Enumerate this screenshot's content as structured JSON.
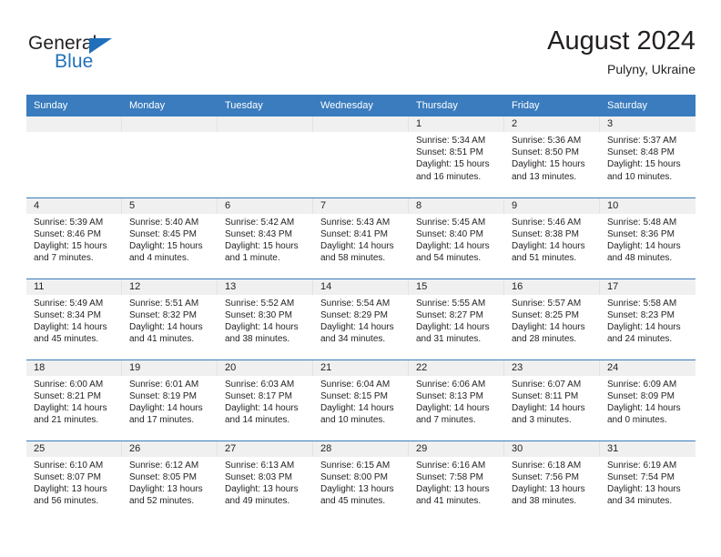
{
  "brand": {
    "name_part1": "General",
    "name_part2": "Blue",
    "triangle_color": "#1f6fba",
    "blue_color": "#2272b8",
    "dark_color": "#231f20"
  },
  "header": {
    "title": "August 2024",
    "subtitle": "Pulyny, Ukraine"
  },
  "theme": {
    "header_bg": "#3a7cbe",
    "daynum_bg": "#f0f0f0",
    "cell_bg": "#ffffff",
    "text": "#231f20"
  },
  "weekday_headers": [
    "Sunday",
    "Monday",
    "Tuesday",
    "Wednesday",
    "Thursday",
    "Friday",
    "Saturday"
  ],
  "labels": {
    "sunrise_prefix": "Sunrise:",
    "sunset_prefix": "Sunset:",
    "daylight_prefix": "Daylight:"
  },
  "weeks": [
    [
      {
        "day": "",
        "empty": true
      },
      {
        "day": "",
        "empty": true
      },
      {
        "day": "",
        "empty": true
      },
      {
        "day": "",
        "empty": true
      },
      {
        "day": "1",
        "sunrise": "Sunrise: 5:34 AM",
        "sunset": "Sunset: 8:51 PM",
        "daylight_l1": "Daylight: 15 hours",
        "daylight_l2": "and 16 minutes."
      },
      {
        "day": "2",
        "sunrise": "Sunrise: 5:36 AM",
        "sunset": "Sunset: 8:50 PM",
        "daylight_l1": "Daylight: 15 hours",
        "daylight_l2": "and 13 minutes."
      },
      {
        "day": "3",
        "sunrise": "Sunrise: 5:37 AM",
        "sunset": "Sunset: 8:48 PM",
        "daylight_l1": "Daylight: 15 hours",
        "daylight_l2": "and 10 minutes."
      }
    ],
    [
      {
        "day": "4",
        "sunrise": "Sunrise: 5:39 AM",
        "sunset": "Sunset: 8:46 PM",
        "daylight_l1": "Daylight: 15 hours",
        "daylight_l2": "and 7 minutes."
      },
      {
        "day": "5",
        "sunrise": "Sunrise: 5:40 AM",
        "sunset": "Sunset: 8:45 PM",
        "daylight_l1": "Daylight: 15 hours",
        "daylight_l2": "and 4 minutes."
      },
      {
        "day": "6",
        "sunrise": "Sunrise: 5:42 AM",
        "sunset": "Sunset: 8:43 PM",
        "daylight_l1": "Daylight: 15 hours",
        "daylight_l2": "and 1 minute."
      },
      {
        "day": "7",
        "sunrise": "Sunrise: 5:43 AM",
        "sunset": "Sunset: 8:41 PM",
        "daylight_l1": "Daylight: 14 hours",
        "daylight_l2": "and 58 minutes."
      },
      {
        "day": "8",
        "sunrise": "Sunrise: 5:45 AM",
        "sunset": "Sunset: 8:40 PM",
        "daylight_l1": "Daylight: 14 hours",
        "daylight_l2": "and 54 minutes."
      },
      {
        "day": "9",
        "sunrise": "Sunrise: 5:46 AM",
        "sunset": "Sunset: 8:38 PM",
        "daylight_l1": "Daylight: 14 hours",
        "daylight_l2": "and 51 minutes."
      },
      {
        "day": "10",
        "sunrise": "Sunrise: 5:48 AM",
        "sunset": "Sunset: 8:36 PM",
        "daylight_l1": "Daylight: 14 hours",
        "daylight_l2": "and 48 minutes."
      }
    ],
    [
      {
        "day": "11",
        "sunrise": "Sunrise: 5:49 AM",
        "sunset": "Sunset: 8:34 PM",
        "daylight_l1": "Daylight: 14 hours",
        "daylight_l2": "and 45 minutes."
      },
      {
        "day": "12",
        "sunrise": "Sunrise: 5:51 AM",
        "sunset": "Sunset: 8:32 PM",
        "daylight_l1": "Daylight: 14 hours",
        "daylight_l2": "and 41 minutes."
      },
      {
        "day": "13",
        "sunrise": "Sunrise: 5:52 AM",
        "sunset": "Sunset: 8:30 PM",
        "daylight_l1": "Daylight: 14 hours",
        "daylight_l2": "and 38 minutes."
      },
      {
        "day": "14",
        "sunrise": "Sunrise: 5:54 AM",
        "sunset": "Sunset: 8:29 PM",
        "daylight_l1": "Daylight: 14 hours",
        "daylight_l2": "and 34 minutes."
      },
      {
        "day": "15",
        "sunrise": "Sunrise: 5:55 AM",
        "sunset": "Sunset: 8:27 PM",
        "daylight_l1": "Daylight: 14 hours",
        "daylight_l2": "and 31 minutes."
      },
      {
        "day": "16",
        "sunrise": "Sunrise: 5:57 AM",
        "sunset": "Sunset: 8:25 PM",
        "daylight_l1": "Daylight: 14 hours",
        "daylight_l2": "and 28 minutes."
      },
      {
        "day": "17",
        "sunrise": "Sunrise: 5:58 AM",
        "sunset": "Sunset: 8:23 PM",
        "daylight_l1": "Daylight: 14 hours",
        "daylight_l2": "and 24 minutes."
      }
    ],
    [
      {
        "day": "18",
        "sunrise": "Sunrise: 6:00 AM",
        "sunset": "Sunset: 8:21 PM",
        "daylight_l1": "Daylight: 14 hours",
        "daylight_l2": "and 21 minutes."
      },
      {
        "day": "19",
        "sunrise": "Sunrise: 6:01 AM",
        "sunset": "Sunset: 8:19 PM",
        "daylight_l1": "Daylight: 14 hours",
        "daylight_l2": "and 17 minutes."
      },
      {
        "day": "20",
        "sunrise": "Sunrise: 6:03 AM",
        "sunset": "Sunset: 8:17 PM",
        "daylight_l1": "Daylight: 14 hours",
        "daylight_l2": "and 14 minutes."
      },
      {
        "day": "21",
        "sunrise": "Sunrise: 6:04 AM",
        "sunset": "Sunset: 8:15 PM",
        "daylight_l1": "Daylight: 14 hours",
        "daylight_l2": "and 10 minutes."
      },
      {
        "day": "22",
        "sunrise": "Sunrise: 6:06 AM",
        "sunset": "Sunset: 8:13 PM",
        "daylight_l1": "Daylight: 14 hours",
        "daylight_l2": "and 7 minutes."
      },
      {
        "day": "23",
        "sunrise": "Sunrise: 6:07 AM",
        "sunset": "Sunset: 8:11 PM",
        "daylight_l1": "Daylight: 14 hours",
        "daylight_l2": "and 3 minutes."
      },
      {
        "day": "24",
        "sunrise": "Sunrise: 6:09 AM",
        "sunset": "Sunset: 8:09 PM",
        "daylight_l1": "Daylight: 14 hours",
        "daylight_l2": "and 0 minutes."
      }
    ],
    [
      {
        "day": "25",
        "sunrise": "Sunrise: 6:10 AM",
        "sunset": "Sunset: 8:07 PM",
        "daylight_l1": "Daylight: 13 hours",
        "daylight_l2": "and 56 minutes."
      },
      {
        "day": "26",
        "sunrise": "Sunrise: 6:12 AM",
        "sunset": "Sunset: 8:05 PM",
        "daylight_l1": "Daylight: 13 hours",
        "daylight_l2": "and 52 minutes."
      },
      {
        "day": "27",
        "sunrise": "Sunrise: 6:13 AM",
        "sunset": "Sunset: 8:03 PM",
        "daylight_l1": "Daylight: 13 hours",
        "daylight_l2": "and 49 minutes."
      },
      {
        "day": "28",
        "sunrise": "Sunrise: 6:15 AM",
        "sunset": "Sunset: 8:00 PM",
        "daylight_l1": "Daylight: 13 hours",
        "daylight_l2": "and 45 minutes."
      },
      {
        "day": "29",
        "sunrise": "Sunrise: 6:16 AM",
        "sunset": "Sunset: 7:58 PM",
        "daylight_l1": "Daylight: 13 hours",
        "daylight_l2": "and 41 minutes."
      },
      {
        "day": "30",
        "sunrise": "Sunrise: 6:18 AM",
        "sunset": "Sunset: 7:56 PM",
        "daylight_l1": "Daylight: 13 hours",
        "daylight_l2": "and 38 minutes."
      },
      {
        "day": "31",
        "sunrise": "Sunrise: 6:19 AM",
        "sunset": "Sunset: 7:54 PM",
        "daylight_l1": "Daylight: 13 hours",
        "daylight_l2": "and 34 minutes."
      }
    ]
  ]
}
